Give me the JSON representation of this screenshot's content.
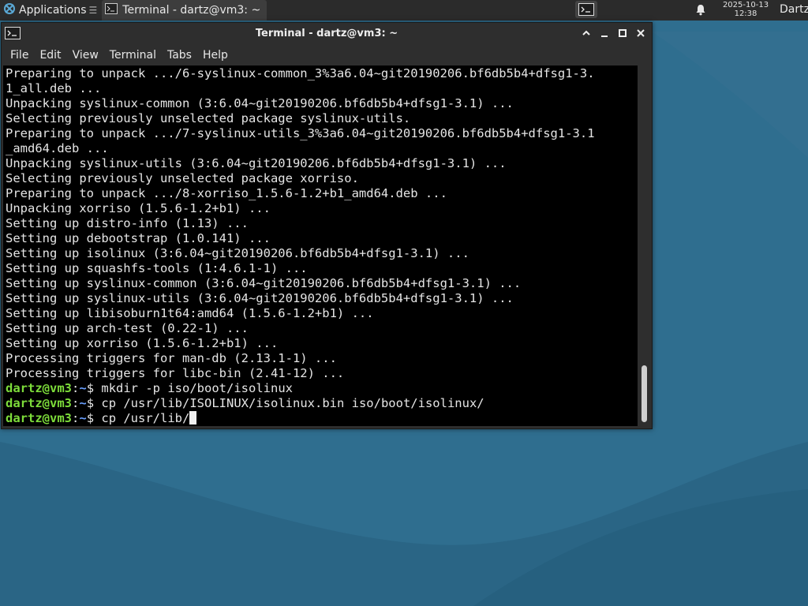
{
  "panel": {
    "applications_label": "Applications",
    "task_title": "Terminal - dartz@vm3: ~",
    "clock_date": "2025-10-13",
    "clock_time": "12:38",
    "user": "Dartz"
  },
  "window": {
    "title": "Terminal - dartz@vm3: ~",
    "menu": [
      "File",
      "Edit",
      "View",
      "Terminal",
      "Tabs",
      "Help"
    ]
  },
  "terminal": {
    "output_lines": [
      "Preparing to unpack .../6-syslinux-common_3%3a6.04~git20190206.bf6db5b4+dfsg1-3.",
      "1_all.deb ...",
      "Unpacking syslinux-common (3:6.04~git20190206.bf6db5b4+dfsg1-3.1) ...",
      "Selecting previously unselected package syslinux-utils.",
      "Preparing to unpack .../7-syslinux-utils_3%3a6.04~git20190206.bf6db5b4+dfsg1-3.1",
      "_amd64.deb ...",
      "Unpacking syslinux-utils (3:6.04~git20190206.bf6db5b4+dfsg1-3.1) ...",
      "Selecting previously unselected package xorriso.",
      "Preparing to unpack .../8-xorriso_1.5.6-1.2+b1_amd64.deb ...",
      "Unpacking xorriso (1.5.6-1.2+b1) ...",
      "Setting up distro-info (1.13) ...",
      "Setting up debootstrap (1.0.141) ...",
      "Setting up isolinux (3:6.04~git20190206.bf6db5b4+dfsg1-3.1) ...",
      "Setting up squashfs-tools (1:4.6.1-1) ...",
      "Setting up syslinux-common (3:6.04~git20190206.bf6db5b4+dfsg1-3.1) ...",
      "Setting up syslinux-utils (3:6.04~git20190206.bf6db5b4+dfsg1-3.1) ...",
      "Setting up libisoburn1t64:amd64 (1.5.6-1.2+b1) ...",
      "Setting up arch-test (0.22-1) ...",
      "Setting up xorriso (1.5.6-1.2+b1) ...",
      "Processing triggers for man-db (2.13.1-1) ...",
      "Processing triggers for libc-bin (2.41-12) ..."
    ],
    "prompt_user": "dartz@vm3",
    "prompt_path": "~",
    "commands": [
      "mkdir -p iso/boot/isolinux",
      "cp /usr/lib/ISOLINUX/isolinux.bin iso/boot/isolinux/",
      "cp /usr/lib/"
    ]
  },
  "colors": {
    "prompt_user": "#7ddc3a",
    "prompt_path": "#6aa0ff",
    "desktop": "#2f6e8f"
  }
}
